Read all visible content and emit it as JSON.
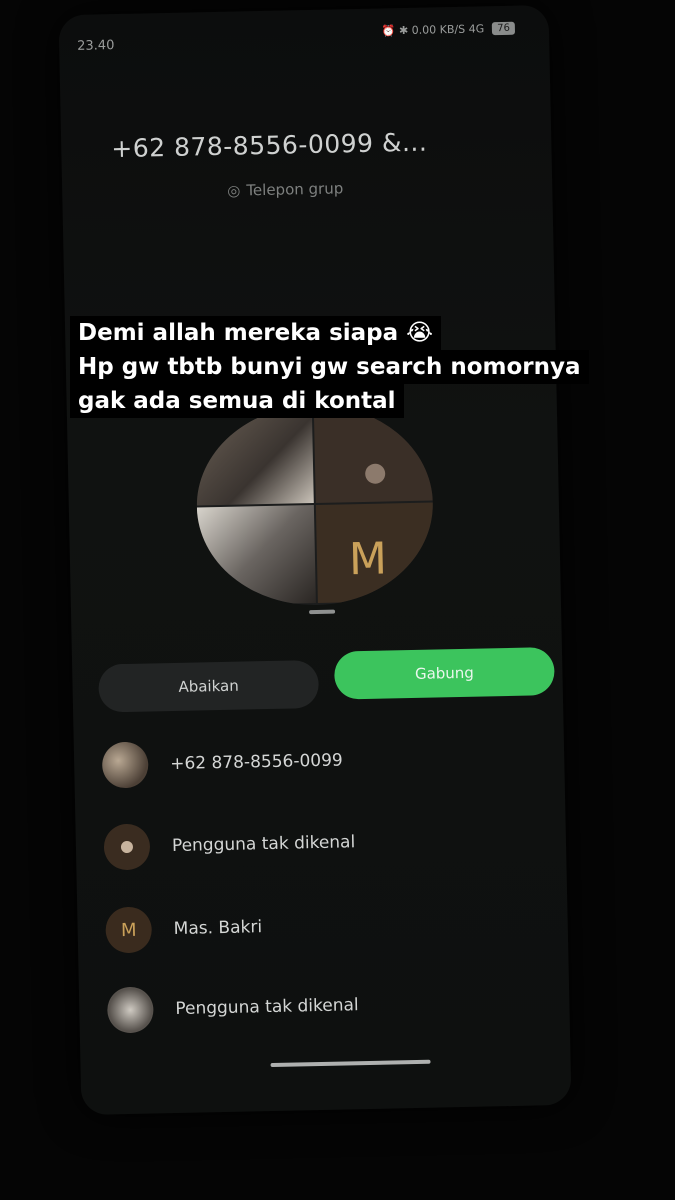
{
  "status": {
    "time": "23.40",
    "icons": "⏰ ✱ 0.00 KB/S 4G",
    "battery": "76"
  },
  "call": {
    "title": "+62 878-8556-0099 &...",
    "subtitle": "Telepon grup",
    "avatar_letter": "M"
  },
  "buttons": {
    "ignore": "Abaikan",
    "join": "Gabung"
  },
  "participants": [
    {
      "name": "+62 878-8556-0099",
      "avatar": "photo"
    },
    {
      "name": "Pengguna tak dikenal",
      "avatar": "user-icon"
    },
    {
      "name": "Mas. Bakri",
      "avatar": "M"
    },
    {
      "name": "Pengguna tak dikenal",
      "avatar": "photo"
    }
  ],
  "caption": {
    "line1": "Demi allah mereka siapa 😭",
    "line2": "Hp gw tbtb bunyi gw search nomornya",
    "line3": "gak ada semua di kontal"
  },
  "colors": {
    "join": "#3cc45d",
    "ignore": "#222424",
    "accent_letter": "#caa15a"
  }
}
